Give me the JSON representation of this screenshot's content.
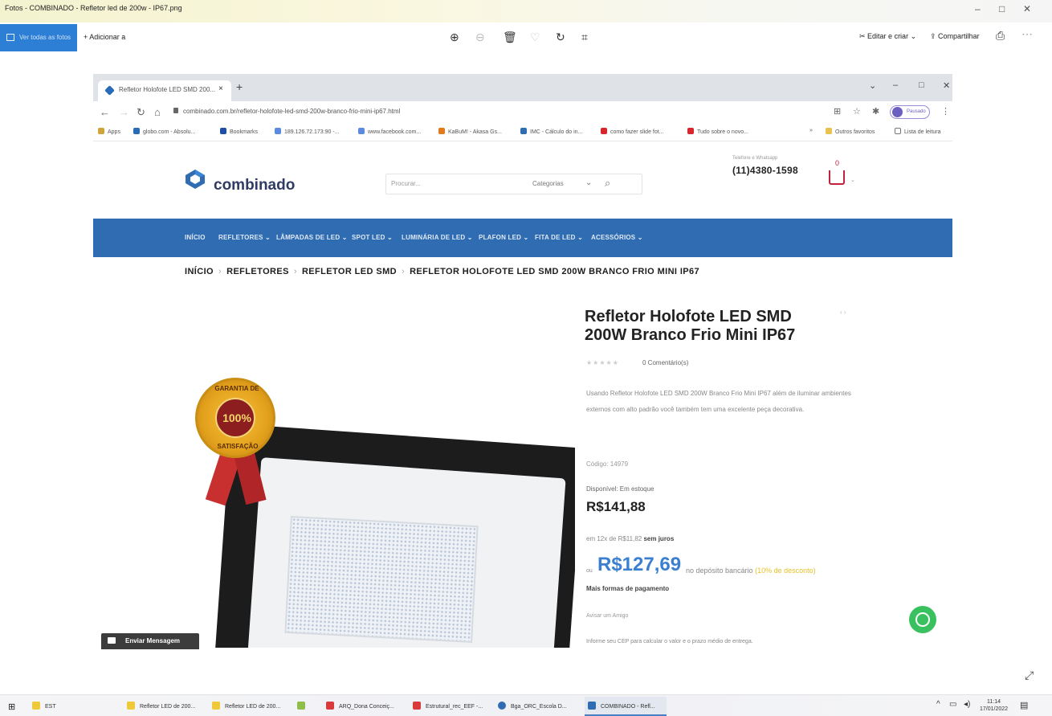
{
  "photos_app": {
    "title": "Fotos - COMBINADO - Refletor led de 200w - IP67.png",
    "window_buttons": [
      "–",
      "□",
      "✕"
    ],
    "see_all_photos": "Ver todas as fotos",
    "add_to": "Adicionar a",
    "edit_create": "Editar e criar",
    "share": "Compartilhar"
  },
  "browser": {
    "tab_title": "Refletor Holofote LED SMD 200...",
    "tab_close": "×",
    "new_tab": "+",
    "url": "combinado.com.br/refletor-holofote-led-smd-200w-branco-frio-mini-ip67.html",
    "profile_label": "Pausado",
    "profile_initial": "V",
    "bookmarks": [
      "Apps",
      "globo.com - Absolu...",
      "Bookmarks",
      "189.126.72.173:90 -...",
      "www.facebook.com...",
      "KaBuM! - Akasa Gs...",
      "IMC - Cálculo do in...",
      "como fazer slide fot...",
      "Tudo sobre o novo..."
    ],
    "bookmarks_more": "»",
    "other_favorites": "Outros favoritos",
    "reading_list": "Lista de leitura"
  },
  "site": {
    "logo_text": "combinado",
    "search_placeholder": "Procurar...",
    "categories_label": "Categorias",
    "phone_label": "Telefone e Whatsapp",
    "phone": "(11)4380-1598",
    "cart_count": "0",
    "nav": [
      "INÍCIO",
      "REFLETORES ⌄",
      "LÂMPADAS DE LED ⌄",
      "SPOT LED ⌄",
      "LUMINÁRIA DE LED ⌄",
      "PLAFON LED ⌄",
      "FITA DE LED ⌄",
      "ACESSÓRIOS ⌄"
    ],
    "breadcrumb": [
      "INÍCIO",
      "REFLETORES",
      "REFLETOR LED SMD",
      "REFLETOR HOLOFOTE LED SMD 200W BRANCO FRIO MINI IP67"
    ]
  },
  "product": {
    "seal_top": "GARANTIA DE",
    "seal_pct": "100%",
    "seal_bottom": "SATISFAÇÃO",
    "title": "Refletor Holofote LED SMD 200W Branco Frio Mini IP67",
    "stars": "★★★★★",
    "reviews": "0 Comentário(s)",
    "description": "Usando Refletor Holofote LED SMD 200W Branco Frio Mini IP67 além de iluminar ambientes externos com alto padrão você também tem uma excelente peça decorativa.",
    "code": "Código: 14979",
    "availability": "Disponível: Em estoque",
    "price": "R$141,88",
    "installments_prefix": "em 12x de R$11,82",
    "installments_bold": "sem juros",
    "discount_prefix": "ou",
    "discount_price": "R$127,69",
    "discount_note": "no depósito bancário",
    "discount_pct": "(10% de desconto)",
    "more_payment": "Mais formas de pagamento",
    "share": "Avisar um Amigo",
    "shipping": "Informe seu CEP para calcular o valor e o prazo médio de entrega.",
    "message_button": "Enviar Mensagem",
    "nav_arrows": "‹  ›"
  },
  "taskbar": {
    "search_label": "EST",
    "items": [
      "Refletor LED de 200...",
      "Refletor LED de 200...",
      "ARQ_Dona Conceiç...",
      "Estrutural_rec_EEF -...",
      "Bga_ORC_Escola D...",
      "COMBINADO - Refl..."
    ],
    "time": "11:14",
    "date": "17/01/2022"
  },
  "colors": {
    "nav_blue": "#2f6cb1",
    "discount_blue": "#3b7fd1",
    "cart_red": "#c3223d",
    "whatsapp_green": "#3ac15f"
  }
}
